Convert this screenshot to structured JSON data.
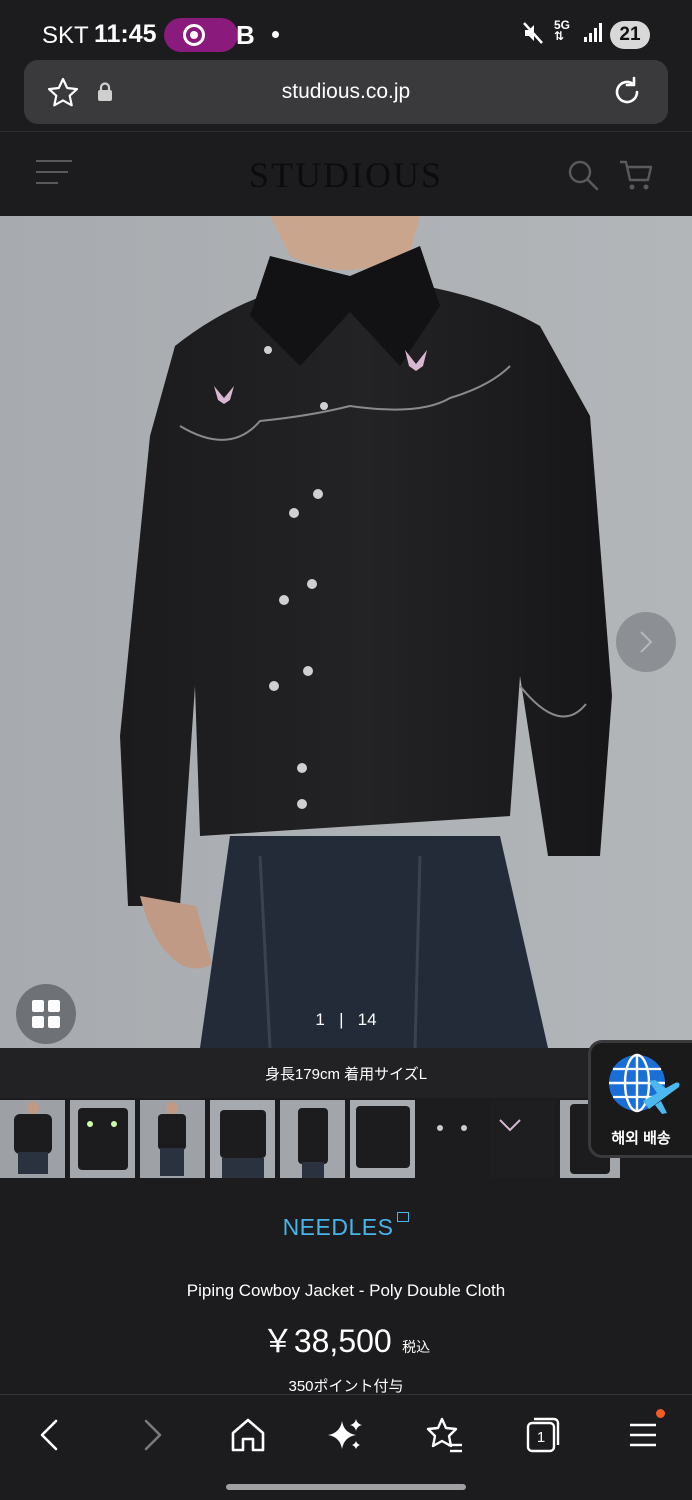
{
  "status_bar": {
    "carrier": "SKT",
    "time": "11:45",
    "b_icon": "B",
    "network": "5G",
    "battery": "21"
  },
  "url_bar": {
    "url": "studious.co.jp"
  },
  "site_header": {
    "logo": "STUDIOUS"
  },
  "gallery": {
    "counter_current": "1",
    "counter_separator": "|",
    "counter_total": "14",
    "caption": "身長179cm 着用サイズL"
  },
  "overseas": {
    "label": "해외 배송"
  },
  "product": {
    "brand": "NEEDLES",
    "name": "Piping Cowboy Jacket - Poly Double Cloth",
    "price": "￥38,500",
    "tax": "税込",
    "points": "350ポイント付与"
  },
  "bottom_nav": {
    "tab_count": "1"
  },
  "colors": {
    "background": "#1c1c1e",
    "brand_link": "#49b4e8",
    "hero_bg": "#a9adb1",
    "notification_dot": "#f25c22"
  }
}
